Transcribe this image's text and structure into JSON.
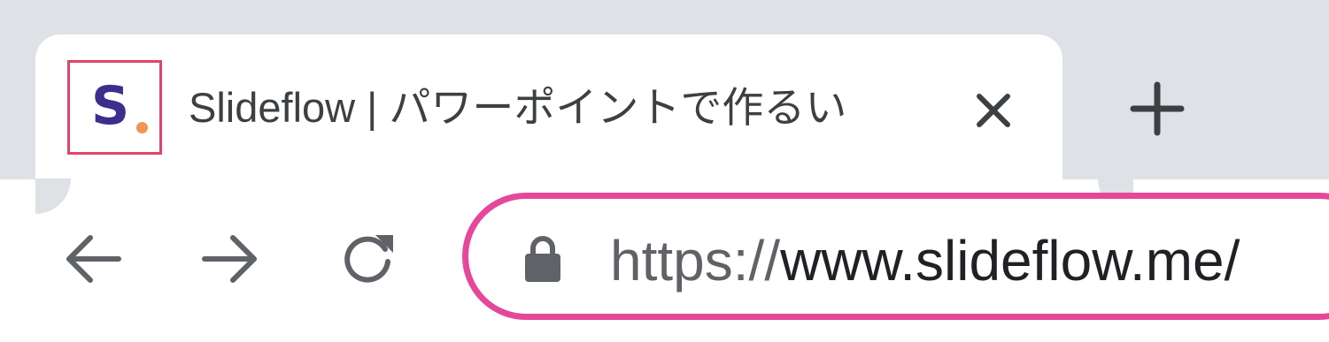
{
  "tab": {
    "title": "Slideflow | パワーポイントで作るい",
    "favicon_letter": "S",
    "favicon_text_color": "#3d2d8c",
    "favicon_dot_color": "#f39355",
    "favicon_highlight_color": "#e0446d",
    "close_icon": "close-icon",
    "new_tab_icon": "plus-icon"
  },
  "toolbar": {
    "back_icon": "arrow-left-icon",
    "forward_icon": "arrow-right-icon",
    "reload_icon": "reload-icon"
  },
  "omnibox": {
    "lock_icon": "lock-icon",
    "scheme": "https://",
    "host": "www.slideflow.me/",
    "highlight_color": "#e5489b"
  },
  "colors": {
    "tabstrip_bg": "#dee1e6",
    "icon_gray": "#5f6368",
    "text_dark": "#202124"
  }
}
